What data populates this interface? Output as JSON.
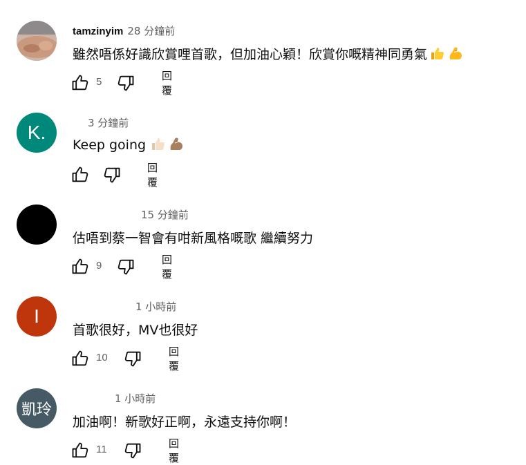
{
  "comments": [
    {
      "author": "tamzinyim",
      "time": "28 分鐘前",
      "text": "雖然唔係好識欣賞哩首歌，但加油心穎！欣賞你嘅精神同勇氣",
      "emojis": [
        "thumbs-up",
        "flexed-biceps"
      ],
      "likes": "5",
      "reply_label": "回覆",
      "avatar": {
        "type": "photo",
        "color": "#b59c90"
      }
    },
    {
      "author": "",
      "time": "3 分鐘前",
      "text": "Keep going",
      "emojis": [
        "thumbs-up-light",
        "flexed-biceps-medium"
      ],
      "likes": "",
      "reply_label": "回覆",
      "avatar": {
        "type": "initial",
        "initial": "K.",
        "color": "#00897b"
      }
    },
    {
      "author": "",
      "time": "15 分鐘前",
      "text": "估唔到蔡一智會有咁新風格嘅歌 繼續努力",
      "emojis": [],
      "likes": "9",
      "reply_label": "回覆",
      "avatar": {
        "type": "solid",
        "color": "#000000"
      }
    },
    {
      "author": "",
      "time": "1 小時前",
      "text": "首歌很好，MV也很好",
      "emojis": [],
      "likes": "10",
      "reply_label": "回覆",
      "avatar": {
        "type": "initial",
        "initial": "I",
        "color": "#bf360c"
      }
    },
    {
      "author": "",
      "time": "1 小時前",
      "text": "加油啊！新歌好正啊，永遠支持你啊！",
      "emojis": [],
      "likes": "11",
      "reply_label": "回覆",
      "avatar": {
        "type": "initial",
        "initial": "凱玲",
        "color": "#455a64"
      }
    }
  ]
}
